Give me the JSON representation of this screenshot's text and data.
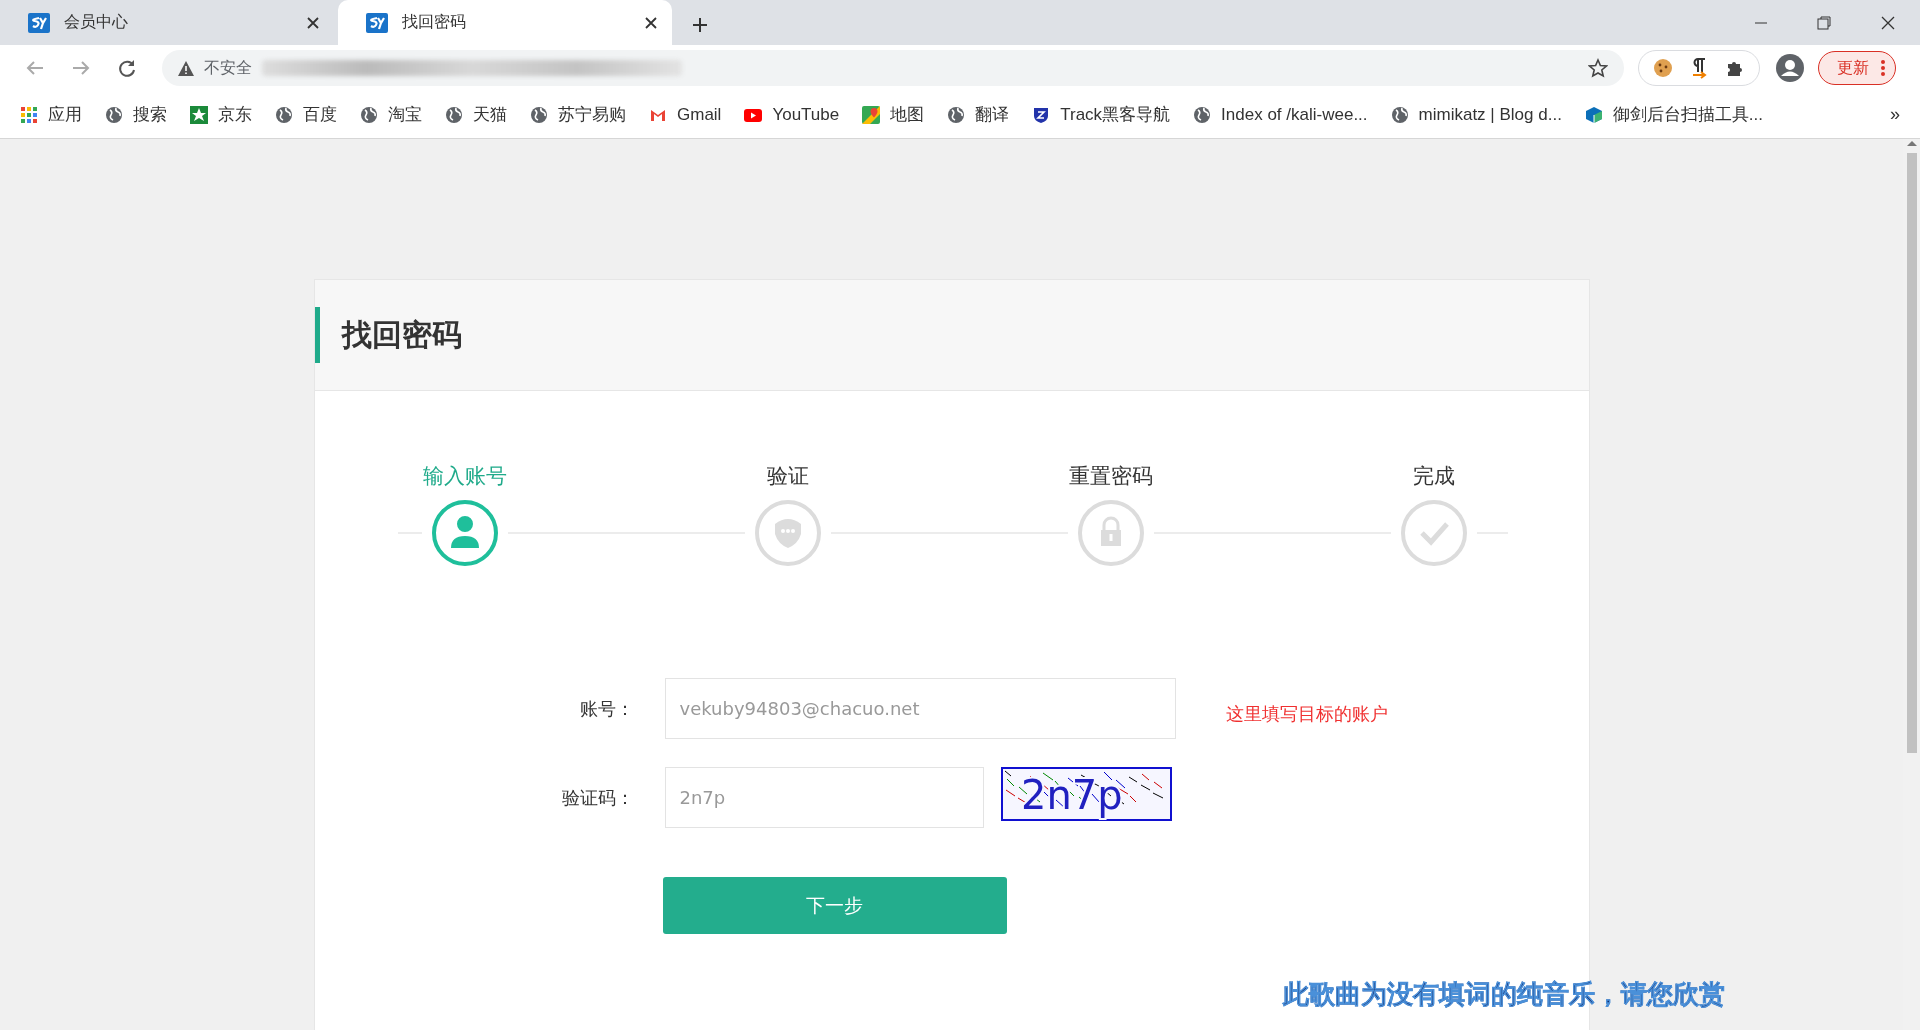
{
  "tabs": [
    {
      "title": "会员中心",
      "selected": false
    },
    {
      "title": "找回密码",
      "selected": true
    }
  ],
  "address_bar": {
    "security_label": "不安全"
  },
  "update_button": "更新",
  "bookmarks": [
    {
      "kind": "apps",
      "label": "应用"
    },
    {
      "kind": "globe",
      "label": "搜索"
    },
    {
      "kind": "jd",
      "label": "京东"
    },
    {
      "kind": "globe",
      "label": "百度"
    },
    {
      "kind": "globe",
      "label": "淘宝"
    },
    {
      "kind": "globe",
      "label": "天猫"
    },
    {
      "kind": "globe",
      "label": "苏宁易购"
    },
    {
      "kind": "gmail",
      "label": "Gmail"
    },
    {
      "kind": "youtube",
      "label": "YouTube"
    },
    {
      "kind": "maps",
      "label": "地图"
    },
    {
      "kind": "globe",
      "label": "翻译"
    },
    {
      "kind": "shield",
      "label": "Track黑客导航"
    },
    {
      "kind": "globe",
      "label": "Index of /kali-wee..."
    },
    {
      "kind": "globe",
      "label": "mimikatz | Blog d..."
    },
    {
      "kind": "cube",
      "label": "御剑后台扫描工具..."
    }
  ],
  "bookmarks_overflow": "»",
  "panel": {
    "title": "找回密码",
    "steps": [
      {
        "label": "输入账号",
        "kind": "user",
        "active": true
      },
      {
        "label": "验证",
        "kind": "shield",
        "active": false
      },
      {
        "label": "重置密码",
        "kind": "lock",
        "active": false
      },
      {
        "label": "完成",
        "kind": "check",
        "active": false
      }
    ],
    "fields": [
      {
        "label": "账号：",
        "value": "vekuby94803@chacuo.net",
        "note": "这里填写目标的账户"
      },
      {
        "label": "验证码：",
        "value": "2n7p"
      }
    ],
    "captcha": "2n7p",
    "submit": "下一步"
  },
  "overlay_caption": "此歌曲为没有填词的纯音乐，请您欣赏"
}
